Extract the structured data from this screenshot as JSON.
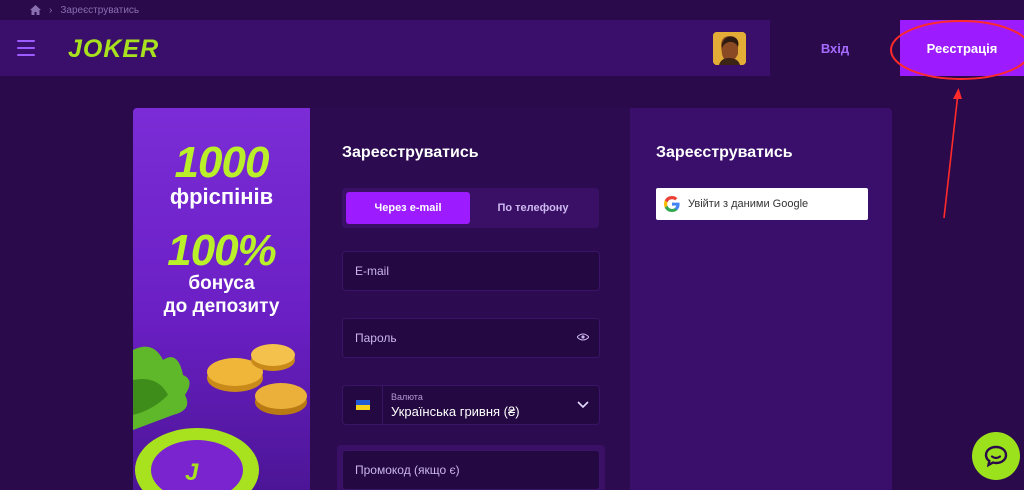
{
  "breadcrumb": {
    "current": "Зареєструватись"
  },
  "header": {
    "logo_text": "JOKER",
    "login_label": "Вхід",
    "register_label": "Реєстрація"
  },
  "promo": {
    "line1": "1000",
    "line2": "фріспінів",
    "line3": "100%",
    "line4": "бонуса",
    "line5": "до депозиту"
  },
  "form": {
    "title": "Зареєструватись",
    "tab_email": "Через e-mail",
    "tab_phone": "По телефону",
    "email_placeholder": "E-mail",
    "password_placeholder": "Пароль",
    "currency_label": "Валюта",
    "currency_value": "Українська гривня (₴)",
    "promo_placeholder": "Промокод (якщо є)"
  },
  "social": {
    "title": "Зареєструватись",
    "google_label": "Увійти з даними Google"
  },
  "colors": {
    "accent": "#9c1cff",
    "brand_green": "#a8e21e",
    "page_bg": "#2a0a4a",
    "annotation": "#ff2a2a"
  }
}
